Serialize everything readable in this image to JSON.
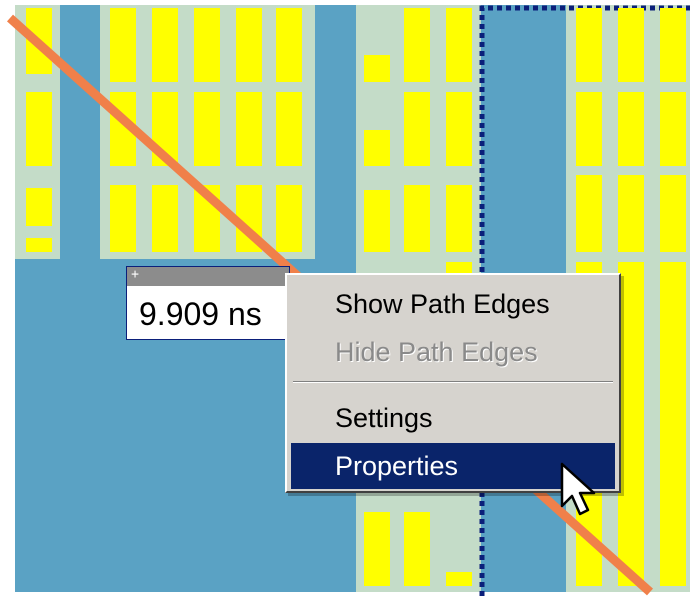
{
  "delay_label": {
    "value": "9.909 ns"
  },
  "context_menu": {
    "items": [
      {
        "label": "Show Path Edges",
        "enabled": true,
        "highlighted": false
      },
      {
        "label": "Hide Path Edges",
        "enabled": false,
        "highlighted": false
      },
      {
        "label": "Settings",
        "enabled": true,
        "highlighted": false
      },
      {
        "label": "Properties",
        "enabled": true,
        "highlighted": true
      }
    ]
  },
  "colors": {
    "background": "#5aa2c4",
    "block_region": "#c4dcc8",
    "cell": "#ffff00",
    "path": "#f0804a",
    "region_outline": "#0b1f7a",
    "menu_background": "#d6d3ce",
    "menu_highlight": "#0a246a"
  },
  "icons": {
    "cursor": "arrow-cursor-icon",
    "grip": "move-grip-icon"
  }
}
